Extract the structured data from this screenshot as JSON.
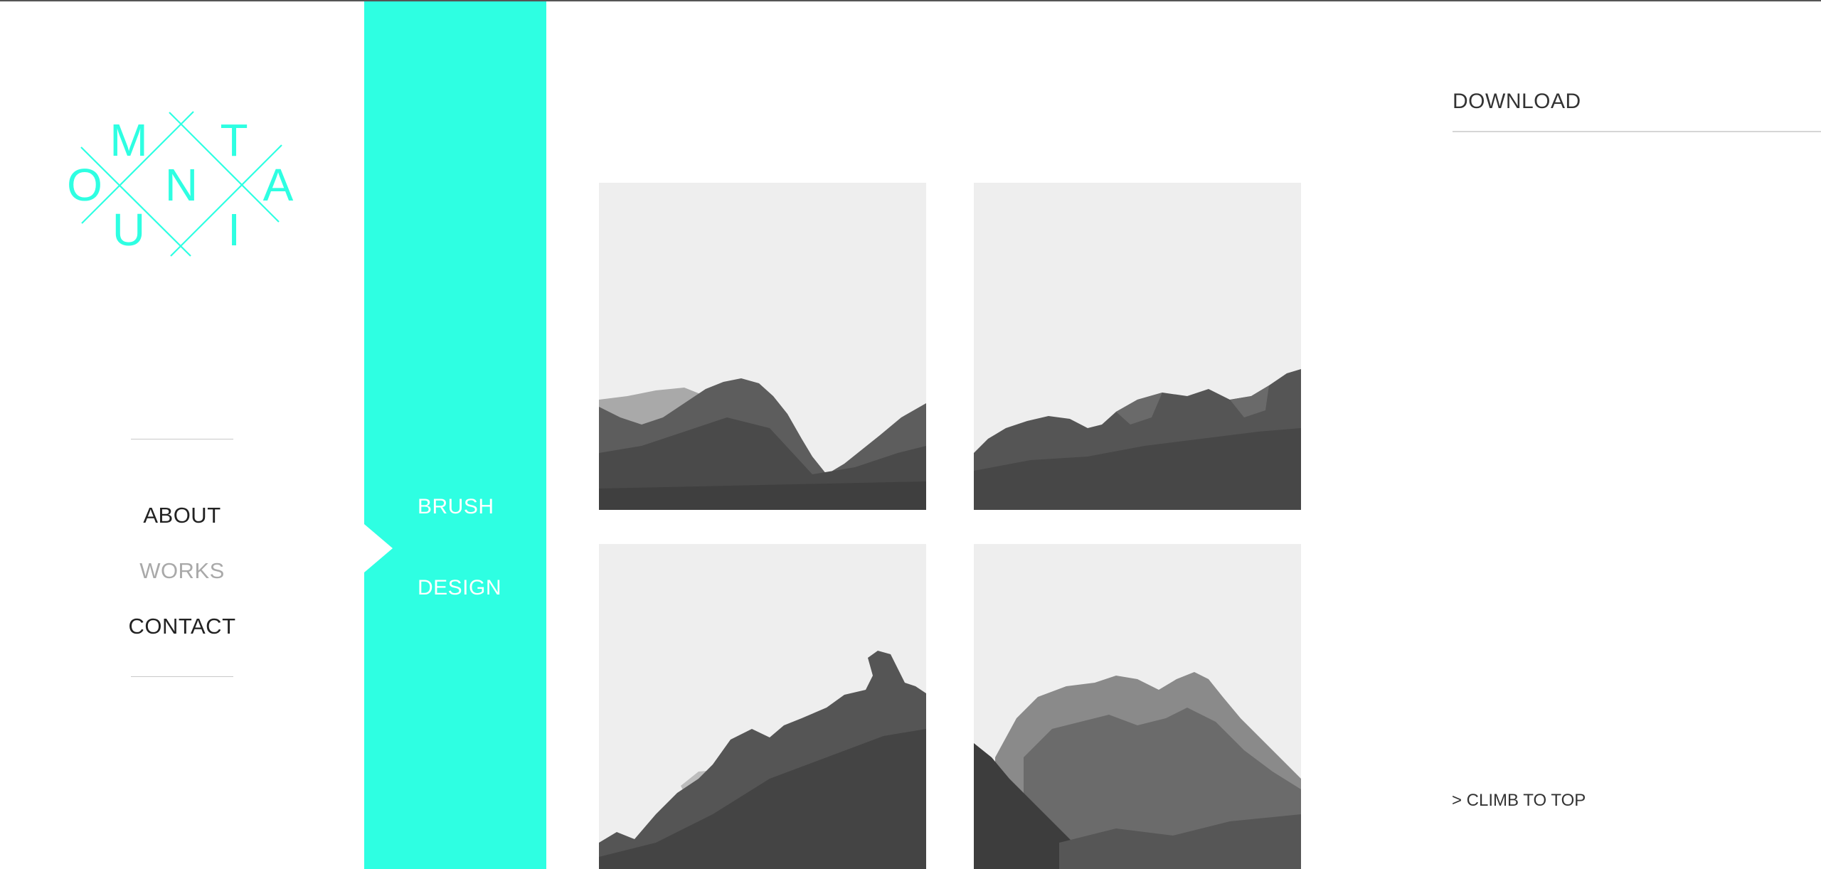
{
  "brand": {
    "logo_letters": [
      "M",
      "T",
      "O",
      "N",
      "A",
      "U",
      "I"
    ],
    "color": "#2effe2"
  },
  "nav": {
    "items": [
      {
        "label": "ABOUT"
      },
      {
        "label": "WORKS",
        "active": true
      },
      {
        "label": "CONTACT"
      }
    ]
  },
  "submenu": {
    "items": [
      {
        "label": "BRUSH"
      },
      {
        "label": "DESIGN"
      }
    ],
    "background": "#2effe2"
  },
  "gallery": {
    "tiles": [
      {
        "subject": "mountain-photo"
      },
      {
        "subject": "mountain-photo"
      },
      {
        "subject": "mountain-photo"
      },
      {
        "subject": "mountain-photo"
      }
    ]
  },
  "sidebar_right": {
    "download_label": "DOWNLOAD",
    "climb_label": "> CLIMB TO TOP"
  }
}
